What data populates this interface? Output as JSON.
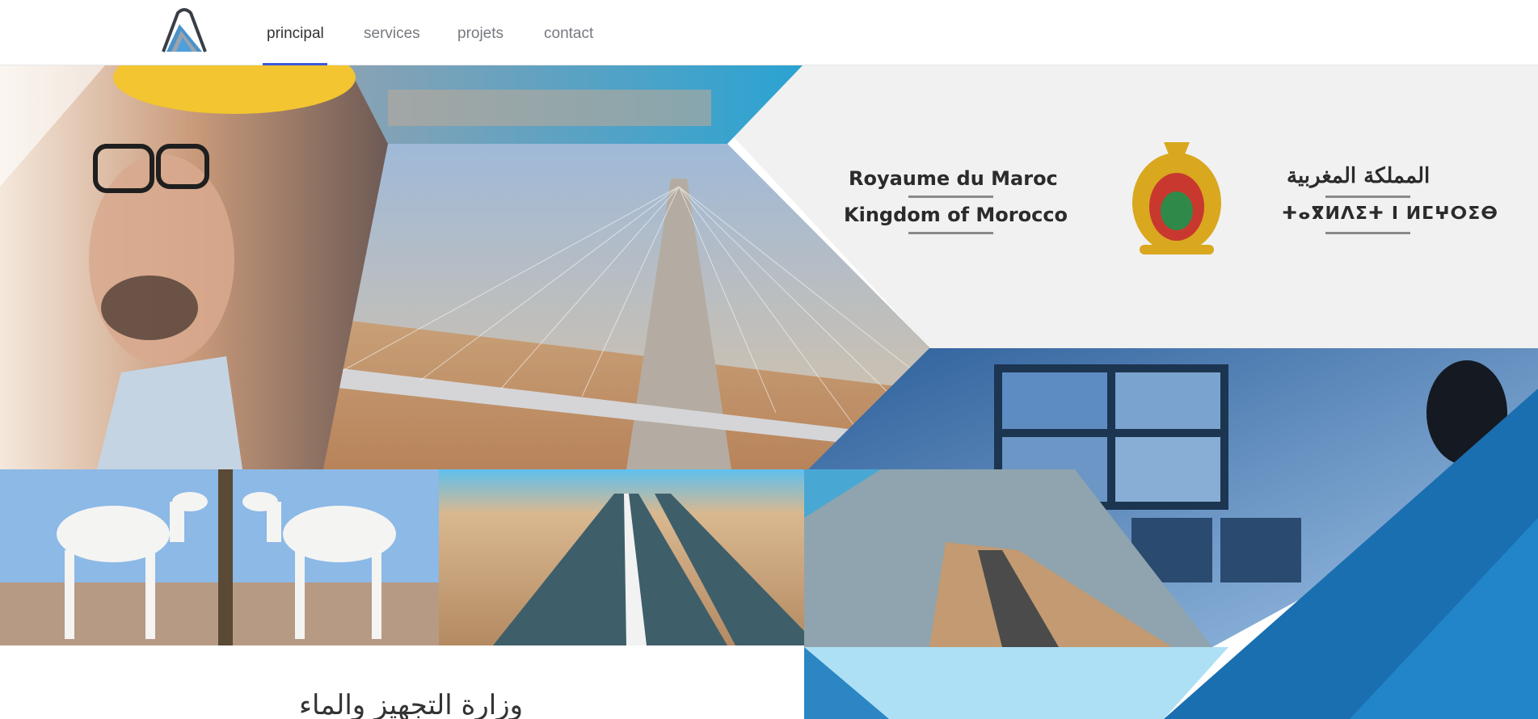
{
  "nav": {
    "items": [
      {
        "label": "principal",
        "active": true
      },
      {
        "label": "services",
        "active": false
      },
      {
        "label": "projets",
        "active": false
      },
      {
        "label": "contact",
        "active": false
      }
    ]
  },
  "emblem": {
    "line1": "Royaume du Maroc",
    "line2": "Kingdom of Morocco",
    "arabic": "المملكة المغربية",
    "tifinagh": "ⵜⴰⴳⵍⴷⵉⵜ ⵏ ⵍⵎⵖⵔⵉⴱ"
  },
  "footer": {
    "arabic_title": "وزارة التجهيز والماء"
  },
  "colors": {
    "accent": "#3b5bdb",
    "blue_dark": "#1a6fb0",
    "blue_light": "#aee0f5",
    "panel_grey": "#f1f1f1"
  }
}
